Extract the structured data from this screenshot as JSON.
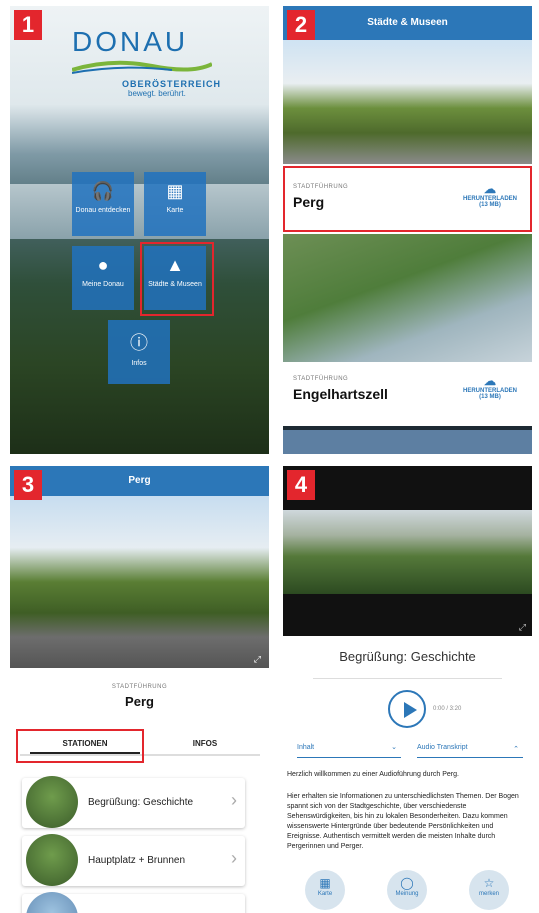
{
  "panel1": {
    "number": "1",
    "logo_title": "DONAU",
    "logo_sub": "OBERÖSTERREICH",
    "logo_tag": "bewegt. berührt.",
    "tiles": [
      {
        "label": "Donau entdecken",
        "icon": "headphones-icon"
      },
      {
        "label": "Karte",
        "icon": "map-icon"
      },
      {
        "label": "Meine Donau",
        "icon": "person-icon"
      },
      {
        "label": "Städte & Museen",
        "icon": "mountains-icon"
      },
      {
        "label": "Infos",
        "icon": "info-icon"
      }
    ]
  },
  "panel2": {
    "number": "2",
    "title": "Städte & Museen",
    "cities": [
      {
        "label": "STADTFÜHRUNG",
        "name": "Perg",
        "download": "HERUNTERLADEN",
        "size": "(13 MB)"
      },
      {
        "label": "STADTFÜHRUNG",
        "name": "Engelhartszell",
        "download": "HERUNTERLADEN",
        "size": "(13 MB)"
      }
    ]
  },
  "panel3": {
    "number": "3",
    "title": "Perg",
    "tour_label": "STADTFÜHRUNG",
    "city": "Perg",
    "tabs": [
      "STATIONEN",
      "INFOS"
    ],
    "stations": [
      "Begrüßung: Geschichte",
      "Hauptplatz + Brunnen"
    ]
  },
  "panel4": {
    "number": "4",
    "title": "Begrüßung: Geschichte",
    "time": "0:00 / 3:20",
    "select_left": "Inhalt",
    "select_right": "Audio Transkript",
    "para1": "Herzlich willkommen zu einer Audioführung durch Perg.",
    "para2": "Hier erhalten sie Informationen zu unterschiedlichsten Themen. Der Bogen spannt sich von der Stadtgeschichte, über verschiedenste Sehenswürdigkeiten, bis hin zu lokalen Besonderheiten. Dazu kommen wissenswerte Hintergründe über bedeutende Persönlichkeiten und Ereignisse. Authentisch vermittelt werden die meisten Inhalte durch Pergerinnen und Perger.",
    "nav": [
      {
        "label": "Karte",
        "icon": "map-icon"
      },
      {
        "label": "Meinung",
        "icon": "speech-bubble-icon"
      },
      {
        "label": "merken",
        "icon": "star-icon"
      }
    ]
  },
  "colors": {
    "accent": "#2c77b8",
    "highlight": "#e3262d"
  }
}
